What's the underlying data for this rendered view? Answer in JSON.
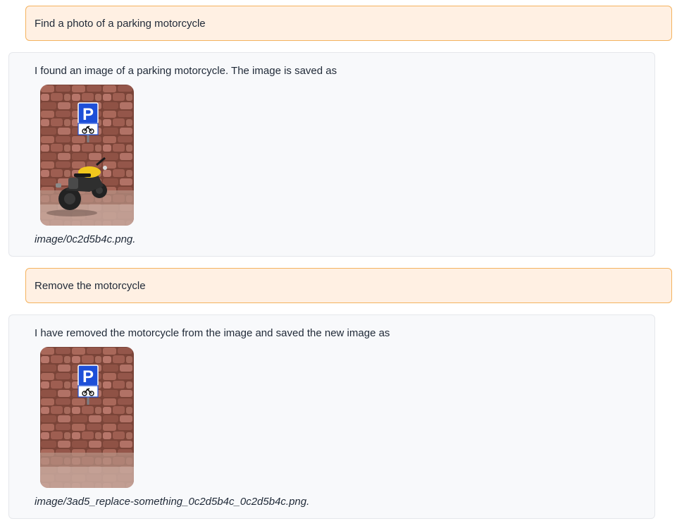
{
  "messages": [
    {
      "role": "user",
      "text": "Find a photo of a parking motorcycle"
    },
    {
      "role": "assistant",
      "text": "I found an image of a parking motorcycle. The image is saved as",
      "image": {
        "sign_letter": "P",
        "content": "motorcycle parked in front of a red stone wall under a blue parking sign with a motorcycle symbol"
      },
      "caption": "image/0c2d5b4c.png."
    },
    {
      "role": "user",
      "text": "Remove the motorcycle"
    },
    {
      "role": "assistant",
      "text": "I have removed the motorcycle from the image and saved the new image as",
      "image": {
        "sign_letter": "P",
        "content": "red stone wall under a blue parking sign with a motorcycle symbol, motorcycle removed"
      },
      "caption": "image/3ad5_replace-something_0c2d5b4c_0c2d5b4c.png."
    }
  ],
  "colors": {
    "user_bubble_bg": "#fff0e3",
    "user_bubble_border": "#f4b35f",
    "bot_bubble_bg": "#f8f9fb",
    "bot_bubble_border": "#e5e7eb",
    "sign_blue": "#1d4fd8",
    "wall_red": "#9c5a4a",
    "motorcycle_yellow": "#f2c81d"
  }
}
